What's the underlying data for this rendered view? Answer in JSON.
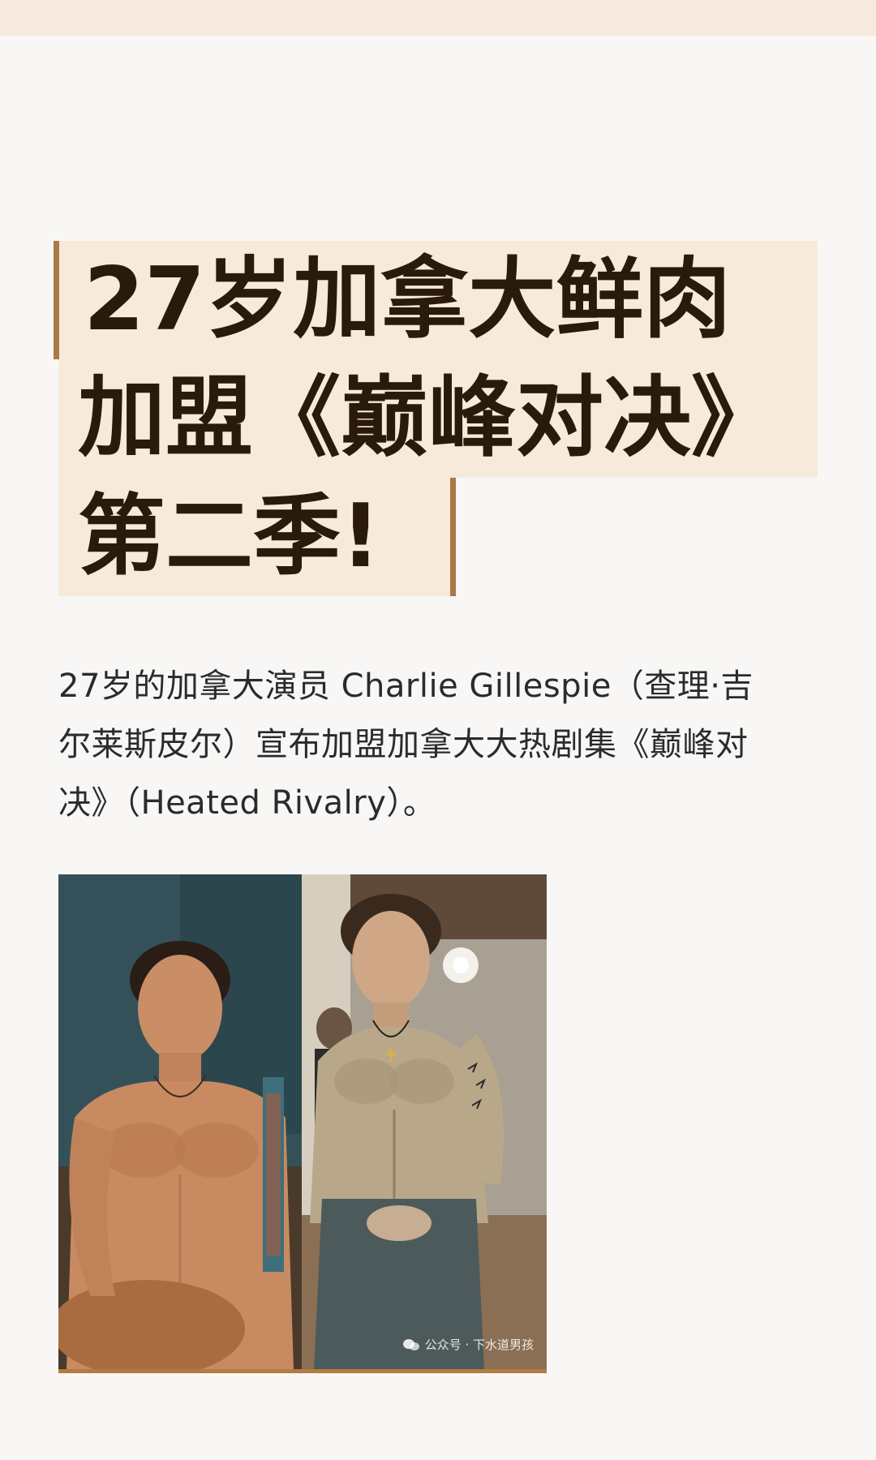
{
  "title": {
    "line1": "27岁加拿大鲜肉",
    "line2": "加盟《巅峰对决》",
    "line3": "第二季!"
  },
  "body": {
    "line1": "27岁的加拿大演员 Charlie Gillespie（查理·吉",
    "line2": "尔莱斯皮尔）宣布加盟加拿大大热剧集《巅峰对",
    "line3": "决》（Heated Rivalry）。"
  },
  "photo": {
    "watermark": "公众号 · 下水道男孩"
  },
  "colors": {
    "accent": "#a97a45",
    "title_bg": "#f8eadb",
    "title_text": "#2a1a0c",
    "top_band": "#f5eadd"
  }
}
